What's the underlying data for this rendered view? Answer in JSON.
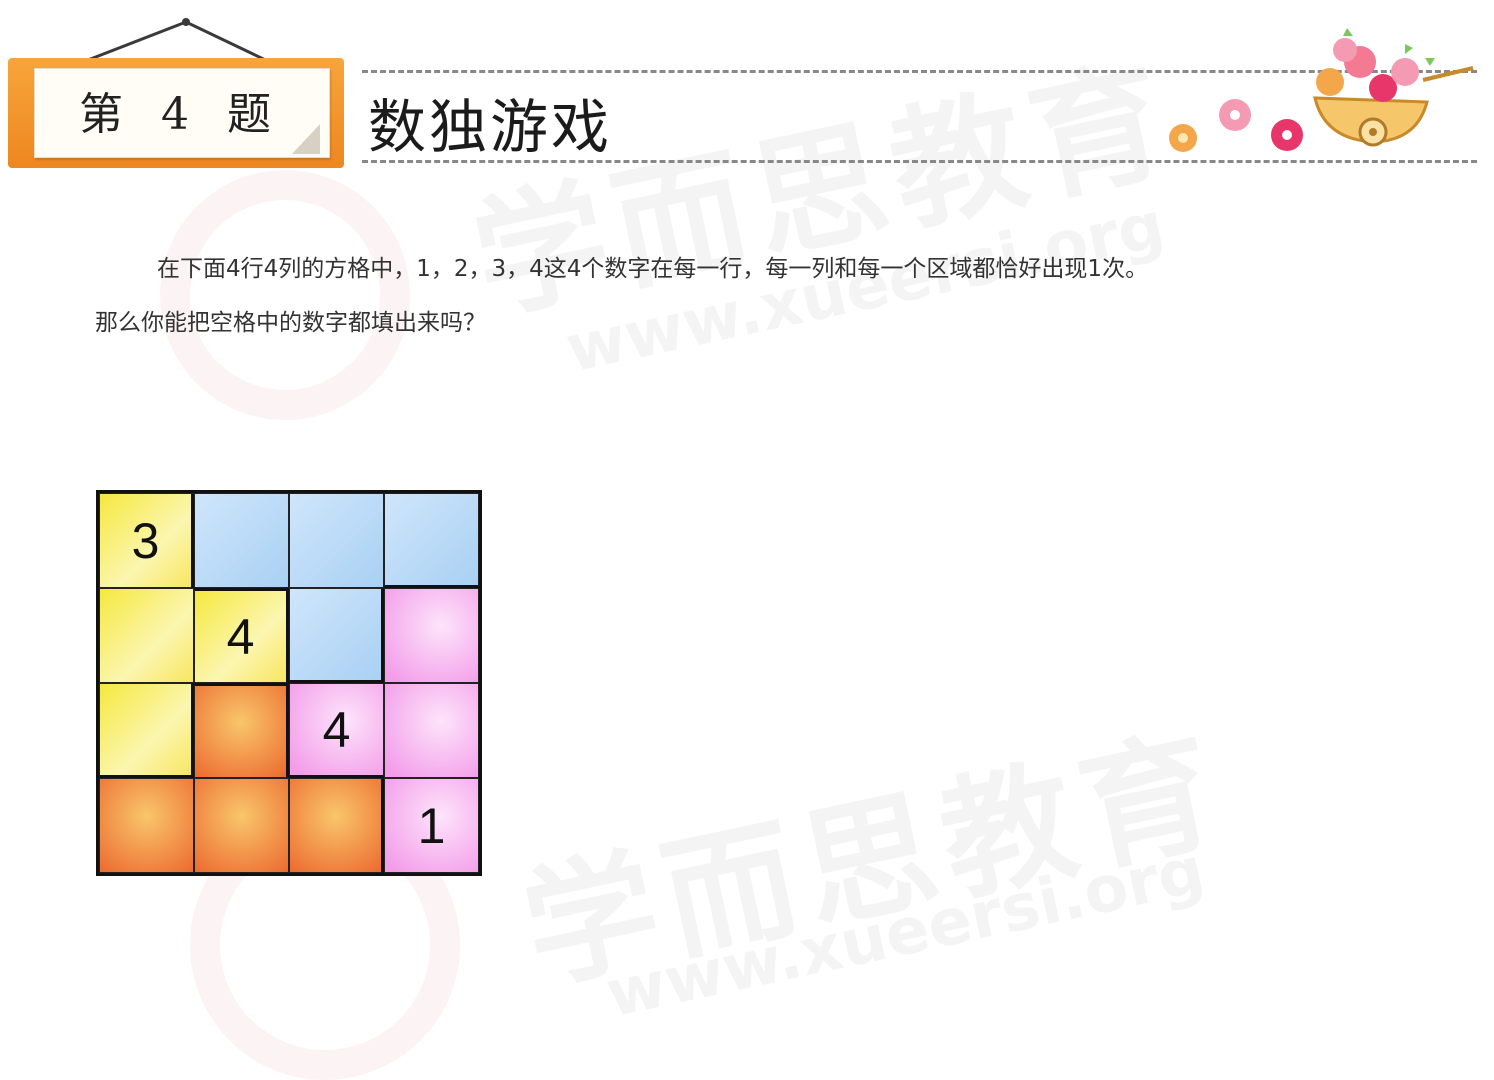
{
  "watermark": {
    "brand_cn": "学而思教育",
    "url": "www.xueersi.org"
  },
  "header": {
    "question_label": "第 4 题",
    "title": "数独游戏",
    "board_color": "#f39a2e"
  },
  "instructions": {
    "line1": "在下面4行4列的方格中，1，2，3，4这4个数字在每一行，每一列和每一个区域都恰好出现1次。",
    "line2": "那么你能把空格中的数字都填出来吗？"
  },
  "sudoku": {
    "size": 4,
    "rows": [
      [
        {
          "value": "3",
          "region": "yellow"
        },
        {
          "value": "",
          "region": "blue"
        },
        {
          "value": "",
          "region": "blue"
        },
        {
          "value": "",
          "region": "blue"
        }
      ],
      [
        {
          "value": "",
          "region": "yellow"
        },
        {
          "value": "4",
          "region": "yellow"
        },
        {
          "value": "",
          "region": "blue"
        },
        {
          "value": "",
          "region": "pink"
        }
      ],
      [
        {
          "value": "",
          "region": "yellow"
        },
        {
          "value": "",
          "region": "orange"
        },
        {
          "value": "4",
          "region": "pink"
        },
        {
          "value": "",
          "region": "pink"
        }
      ],
      [
        {
          "value": "",
          "region": "orange"
        },
        {
          "value": "",
          "region": "orange"
        },
        {
          "value": "",
          "region": "orange"
        },
        {
          "value": "1",
          "region": "pink"
        }
      ]
    ],
    "region_colors": {
      "yellow": "#f6e83e",
      "blue": "#b3d7f5",
      "pink": "#f39ce9",
      "orange": "#ef8a3a"
    }
  }
}
